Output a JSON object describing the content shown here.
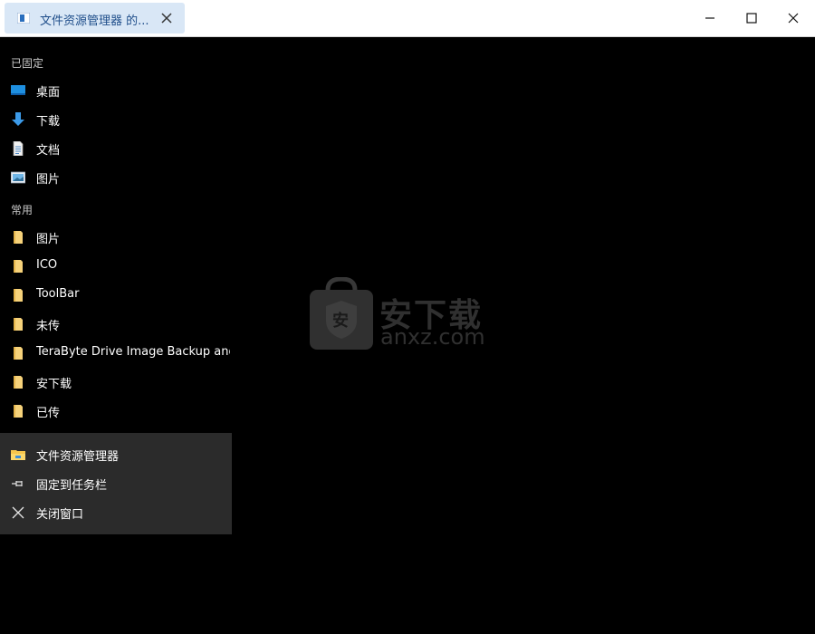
{
  "window": {
    "tab_title": "文件资源管理器 的...",
    "tab_color": "#d9e7f6"
  },
  "pinned": {
    "label": "已固定",
    "items": [
      {
        "label": "桌面",
        "icon": "desktop-icon"
      },
      {
        "label": "下载",
        "icon": "download-arrow-icon"
      },
      {
        "label": "文档",
        "icon": "document-icon"
      },
      {
        "label": "图片",
        "icon": "pictures-icon"
      }
    ]
  },
  "frequent": {
    "label": "常用",
    "items": [
      {
        "label": "图片",
        "icon": "folder-icon"
      },
      {
        "label": "ICO",
        "icon": "folder-icon"
      },
      {
        "label": "ToolBar",
        "icon": "folder-icon"
      },
      {
        "label": "未传",
        "icon": "folder-icon"
      },
      {
        "label": "TeraByte Drive Image Backup and R...",
        "icon": "folder-icon"
      },
      {
        "label": "安下载",
        "icon": "folder-icon"
      },
      {
        "label": "已传",
        "icon": "folder-icon"
      }
    ]
  },
  "context_menu": {
    "items": [
      {
        "label": "文件资源管理器",
        "icon": "file-explorer-icon"
      },
      {
        "label": "固定到任务栏",
        "icon": "pin-icon"
      },
      {
        "label": "关闭窗口",
        "icon": "close-icon"
      }
    ]
  },
  "watermark": {
    "text": "安下载",
    "subtext": "anxz.com",
    "badge": "安"
  }
}
